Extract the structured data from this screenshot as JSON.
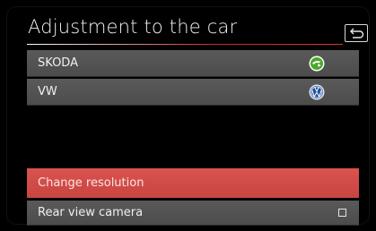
{
  "header": {
    "title": "Adjustment to the car",
    "back_icon": "back-arrow-icon"
  },
  "menu": {
    "brands": [
      {
        "label": "SKODA",
        "icon": "skoda-logo-icon",
        "icon_color": "#4ba82e"
      },
      {
        "label": "VW",
        "icon": "vw-logo-icon",
        "icon_color": "#1f4e9a"
      }
    ],
    "change_resolution": {
      "label": "Change resolution"
    },
    "rear_camera": {
      "label": "Rear view camera",
      "checked": false
    }
  },
  "colors": {
    "accent": "#d9534f",
    "row": "#555555",
    "background": "#000000"
  }
}
